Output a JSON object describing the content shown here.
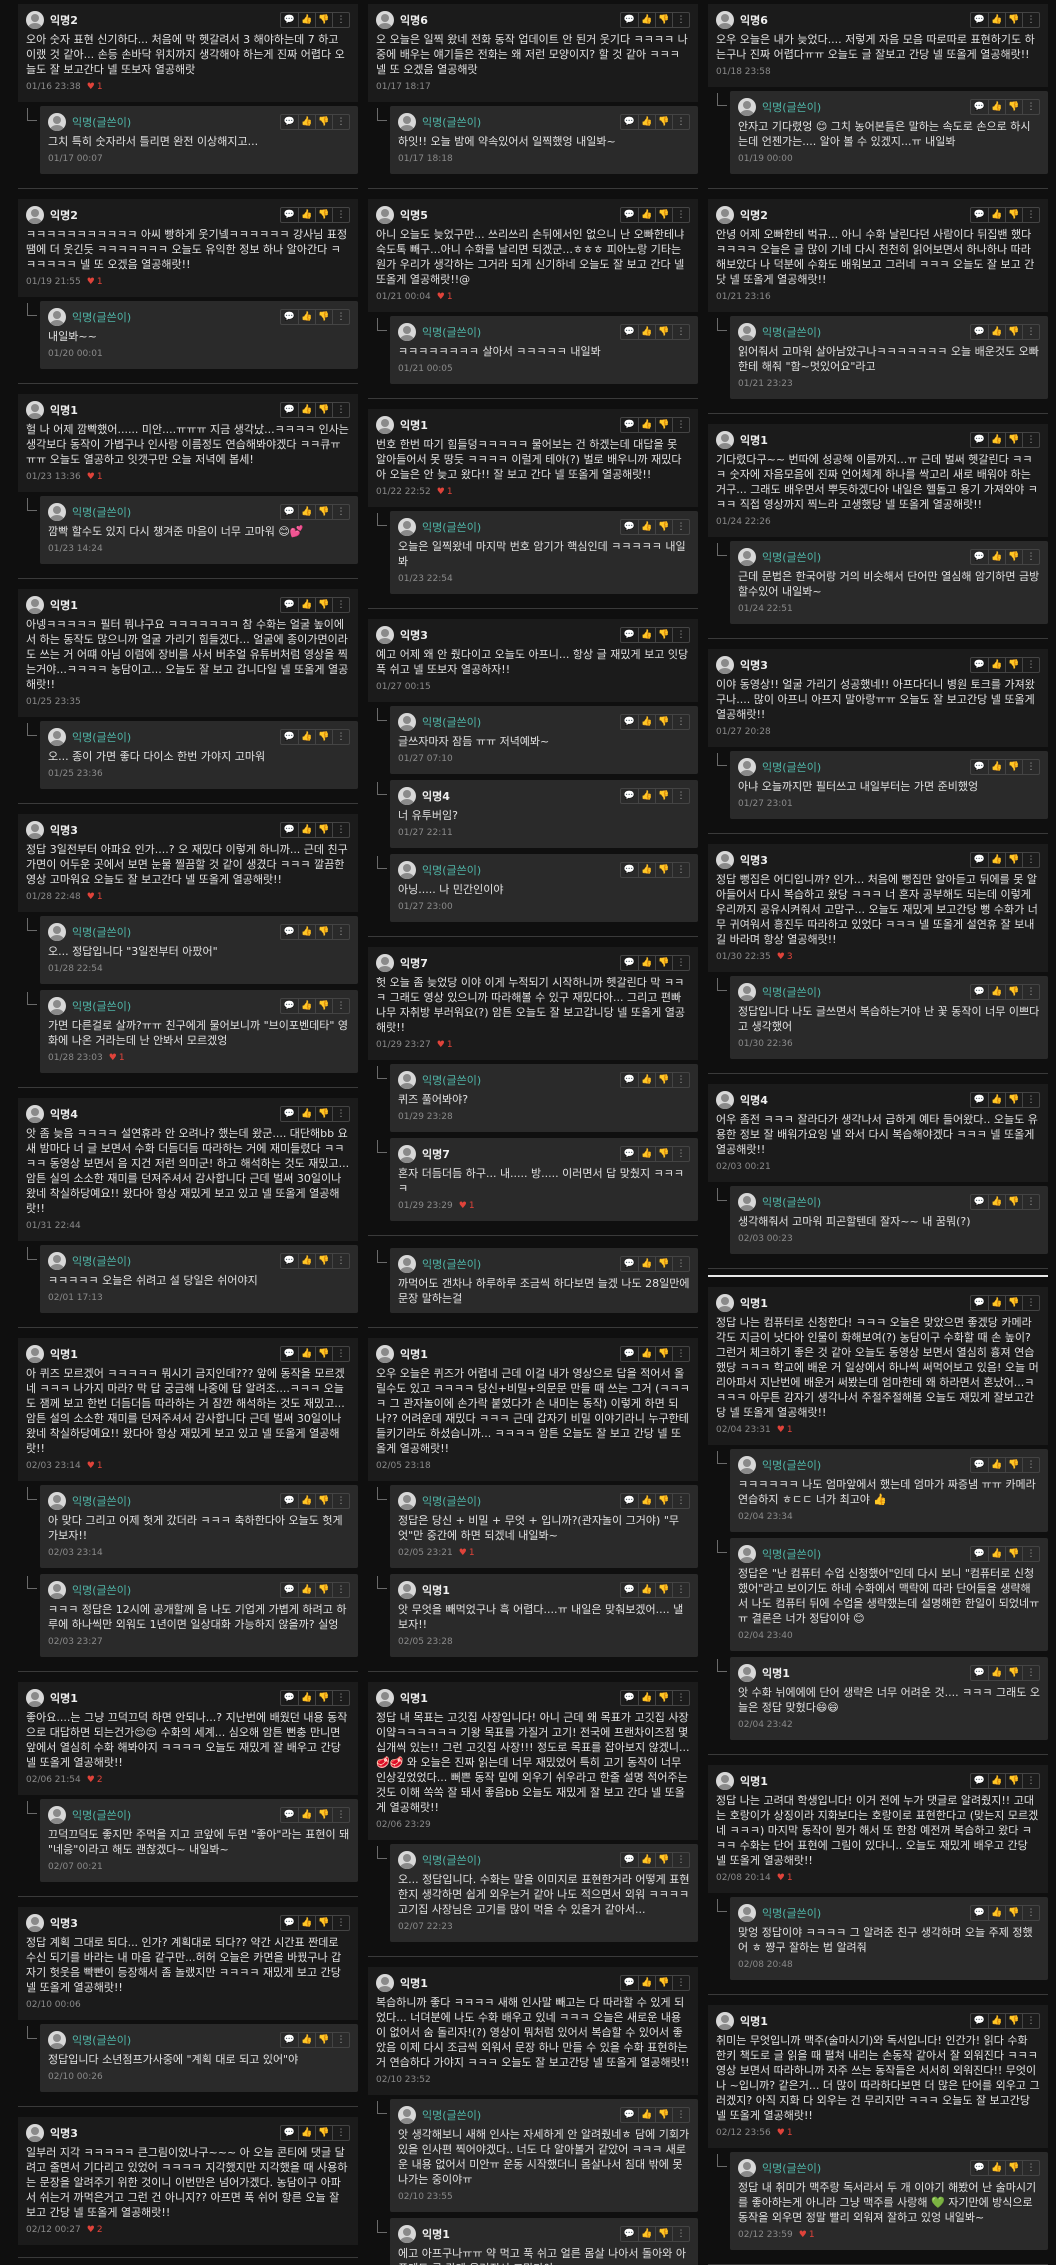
{
  "icons": {
    "comment": "speech-bubble-icon",
    "like": "thumbs-up-icon",
    "dislike": "thumbs-down-icon",
    "more": "more-icon",
    "heart": "heart-icon"
  },
  "columns": [
    [
      {
        "name": "익명2",
        "text": "오아 숫자 표현 신기하다... 처음에 막 헷갈려서 3 해야하는데 7 하고 이랬 것 같아... 손등 손바닥 위치까지 생각해야 하는게 진짜 어렵다 오늘도 잘 보고간다 넬 또보자 열공해랏",
        "time": "01/16 23:38",
        "likes": "1",
        "replies": [
          {
            "name": "익명(글쓴이)",
            "op": true,
            "text": "그치 특히 숫자라서 틀리면 완전 이상해지고...",
            "time": "01/17 00:07",
            "likes": ""
          }
        ]
      },
      {
        "name": "익명2",
        "text": "ㅋㅋㅋㅋㅋㅋㅋㅋㅋㅋㅋ 아씨 빵하게 웃기넼ㅋㅋㅋㅋㅋㅋ 강사님 표정 땜에 더 웃긴듯 ㅋㅋㅋㅋㅋㅋㅋ 오늘도 유익한 정보 하나 알아간다 ㅋㅋㅋㅋㅋㅋ 넬 또 오겠음 열공해랏!!",
        "time": "01/19 21:55",
        "likes": "1",
        "replies": [
          {
            "name": "익명(글쓴이)",
            "op": true,
            "text": "내일봐~~",
            "time": "01/20 00:01",
            "likes": ""
          }
        ]
      },
      {
        "name": "익명1",
        "text": "헐 나 어제 깜빡했어...... 미안....ㅠㅠㅠ 지금 생각났...ㅋㅋㅋㅋ 인사는 생각보다 동작이 가볍구나 인사랑 이름정도 연습해봐야겠다 ㅋㅋ큐ㅠㅠㅠ 오늘도 열공하고 잇갯구만 오늘 저녁에 봅세!",
        "time": "01/23 13:36",
        "likes": "1",
        "replies": [
          {
            "name": "익명(글쓴이)",
            "op": true,
            "text": "깜빡 할수도 있지 다시 챙겨준 마음이 너무 고마워 😊💕",
            "time": "01/23 14:24",
            "likes": ""
          }
        ]
      },
      {
        "name": "익명1",
        "text": "아넹ㅋㅋㅋㅋㅋ 필터 뭐냐구요 ㅋㅋㅋㅋㅋㅋㅋ 참 수화는 얼굴 높이에서 하는 동작도 많으니까 얼굴 가리기 힘들겠다... 얼굴에 종이가면이라도 쓰는 거 어떄 아님 이럼에 장비를 사서 버추얼 유튜버처럼 영상을 찍는거야...ㅋㅋㅋㅋ 농담이고... 오늘도 잘 보고 갑니다일 넬 또올게 열공해랏!!",
        "time": "01/25 23:35",
        "likes": "",
        "replies": [
          {
            "name": "익명(글쓴이)",
            "op": true,
            "text": "오... 종이 가면 좋다 다이소 한번 가야지 고마워",
            "time": "01/25 23:36",
            "likes": ""
          }
        ]
      },
      {
        "name": "익명3",
        "text": "정답 3일전부터 아파요 인가....? 오 재밌다 이렇게 하니까... 근데 친구 가면이 어두운 곳에서 보면 눈물 찔끔할 것 같이 생겼다 ㅋㅋㅋ 깔끔한 영상 고마워요 오늘도 잘 보고간다 넬 또올게 열공해랏!!",
        "time": "01/28 22:48",
        "likes": "1",
        "replies": [
          {
            "name": "익명(글쓴이)",
            "op": true,
            "text": "오... 정답입니다 \"3일전부터 아팠어\"",
            "time": "01/28 22:54",
            "likes": ""
          },
          {
            "name": "익명(글쓴이)",
            "op": true,
            "text": "가면 다른걸로 살까?ㅠㅠ 친구에게 물어보니까 \"브이포벤데타\" 영화에 나온 거라는데 난 안봐서 모르겠엉",
            "time": "01/28 23:03",
            "likes": "1"
          }
        ]
      },
      {
        "name": "익명4",
        "text": "앗 좀 늦음 ㅋㅋㅋㅋ 설연휴라 안 오려나? 했는데 왔군.... 대단해bb 요새 밤마다 너 글 보면서 수화 더듬더듬 따라하는 거에 재미들렸다 ㅋㅋㅋㅋ 동영상 보면서 음 지건 저런 의미군! 하고 해석하는 것도 재밌고... 암튼 실의 소소한 재미를 던져주셔서 감사합니다 근데 벌써 30일이나 왔네 착실하당예요!! 왔다아 항상 재밌게 보고 있고 넬 또올게 열공해랏!!",
        "time": "01/31 22:44",
        "likes": "",
        "replies": [
          {
            "name": "익명(글쓴이)",
            "op": true,
            "text": "ㅋㅋㅋㅋㅋ 오늘은 쉬려고 설 당일은 쉬어야지",
            "time": "02/01 17:13",
            "likes": ""
          }
        ]
      },
      {
        "name": "익명1",
        "text": "아 퀴즈 모르겠어 ㅋㅋㅋㅋㅋ 뭐시기 금지인데??? 앞에 동작을 모르겠네 ㅋㅋㅋ 나가지 마라? 막 답 궁금해 나중에 답 알려조....ㅋㅋㅋ 오늘도 잼께 보고 한번 더듬더듬 따라하는 거 잠깐 해석하는 것도 재밌고... 암튼 설의 소소한 재미를 던져주셔서 감사합니다 근데 벌써 30일이나 왔네 착실하당예요!! 왔다아 항상 재밌게 보고 있고 넬 또올게 열공해랏!!",
        "time": "02/03 23:14",
        "likes": "1",
        "replies": [
          {
            "name": "익명(글쓴이)",
            "op": true,
            "text": "아 맞다 그리고 어제 헛게 갔더라 ㅋㅋㅋ 축하한다아 오늘도 헛게 가보자!!",
            "time": "02/03 23:14",
            "likes": ""
          },
          {
            "name": "익명(글쓴이)",
            "op": true,
            "text": "ㅋㅋㅋ 정답은 12시에 공개할께 음 나도 기업게 가볍게 하려고 하루에 하나씩만 외워도 1년이면 일상대화 가능하지 않을까? 실엉",
            "time": "02/03 23:27",
            "likes": ""
          }
        ]
      },
      {
        "name": "익명1",
        "text": "좋아요....는 그냥 끄덕끄덕 하면 안되나...? 지난번에 배웠던 내용 동작으로 대답하면 되는건가😌😌 수화의 세계... 심오해 암튼 뻔충 만니면 앞에서 열심히 수화 해봐야지 ㅋㅋㅋㅋ 오늘도 재밌게 잘 배우고 간당 넬 또올게 열공해랏!!",
        "time": "02/06 21:54",
        "likes": "2",
        "replies": [
          {
            "name": "익명(글쓴이)",
            "op": true,
            "text": "끄덕끄덕도 좋지만 주먹을 지고 코앞에 두면 \"좋아\"라는 표현이 돼 \"네응\"이라고 해도 괜찮겠다~ 내일봐~",
            "time": "02/07 00:21",
            "likes": ""
          }
        ]
      },
      {
        "name": "익명3",
        "text": "정답 계획 그대로 되다... 인가? 계획대로 되다?? 약간 시간표 짠데로 수신 되기를 바라는 내 마음 같구만...허허 오늘은 카면을 바꿨구나 갑자기 헛웃음 빡빤이 등장해서 좀 놀랬지만 ㅋㅋㅋㅋ 재밌게 보고 간당 넬 또올게 열공해랏!!",
        "time": "02/10 00:06",
        "likes": "",
        "replies": [
          {
            "name": "익명(글쓴이)",
            "op": true,
            "text": "정답입니다 소년점프가사중에 \"계획 대로 되고 있어\"야",
            "time": "02/10 00:26",
            "likes": ""
          }
        ]
      },
      {
        "name": "익명3",
        "text": "일부러 지각 ㅋㅋㅋㅋㅋ 큰그림이었나구~~~ 아 오늘 콘티에 댓글 달려고 줄면서 기다리고 있었어 ㅋㅋㅋㅋ 지각했지만 지각했을 때 사용하는 문장을 알려주기 위한 것이니 이번만은 넘어가겠다. 농담이구 아파서 쉬는거 까먹은거고 그런 건 아니지?? 아프면 푹 쉬어 항른 오늘 잘 보고 간당 넬 또올게 열공해랏!!",
        "time": "02/12 00:27",
        "likes": "2",
        "replies": []
      }
    ],
    [
      {
        "name": "익명6",
        "text": "오 오늘은 일찍 왔네 전화 동작 업데이트 안 된거 웃기다 ㅋㅋㅋㅋ 나중에 배우는 얘기들은 전화는 왜 저런 모양이지? 할 것 같아 ㅋㅋㅋ 넬 또 오겠음 열공해랏",
        "time": "01/17 18:17",
        "likes": "",
        "replies": [
          {
            "name": "익명(글쓴이)",
            "op": true,
            "text": "하잇!! 오늘 밤에 약속있어서 일찍했엉 내일봐~",
            "time": "01/17 18:18",
            "likes": ""
          }
        ]
      },
      {
        "name": "익명5",
        "text": "아니 오늘도 늦었구만... 쓰리쓰리 손뒤에서인 없으니 난 오빠한테냐 숙도톡 빼구...아니 수화를 날리면 되겠군...ㅎㅎㅎ 피아노랑 기타는 원가 우리가 생각하는 그거라 되게 신기하네 오늘도 잘 보고 간다 넬 또올게 열공해랏!!@",
        "time": "01/21 00:04",
        "likes": "1",
        "replies": [
          {
            "name": "익명(글쓴이)",
            "op": true,
            "text": "ㅋㅋㅋㅋㅋㅋㅋㅋ 살아서 ㅋㅋㅋㅋㅋ 내일봐",
            "time": "01/21 00:05",
            "likes": ""
          }
        ]
      },
      {
        "name": "익명1",
        "text": "번호 한번 따기 힘들덩ㅋㅋㅋㅋㅋ 물어보는 건 하겠는데 대답을 못 알아들어서 못 땅듯 ㅋㅋㅋㅋ 이럴게 테야(?) 벌로 배우니까 재밌다아 오늘은 안 늦고 왔다!! 잘 보고 간다 넬 또올게 열공해랏!!",
        "time": "01/22 22:52",
        "likes": "1",
        "replies": [
          {
            "name": "익명(글쓴이)",
            "op": true,
            "text": "오늘은 일찍왔네 마지막 번호 암기가 핵심인데 ㅋㅋㅋㅋㅋ 내일봐",
            "time": "01/23 22:54",
            "likes": ""
          }
        ]
      },
      {
        "name": "익명3",
        "text": "예고 어제 왜 안 줬다이고 오늘도 아프니... 항상 글 재밌게 보고 잇당 푹 쉬고 넬 또보자 열공하자!!",
        "time": "01/27 00:15",
        "likes": "",
        "replies": [
          {
            "name": "익명(글쓴이)",
            "op": true,
            "text": "글쓰자마자 잠듬 ㅠㅠ 저녁예봐~",
            "time": "01/27 07:10",
            "likes": ""
          },
          {
            "name": "익명4",
            "op": false,
            "text": "너 유투버임?",
            "time": "01/27 22:11",
            "likes": ""
          },
          {
            "name": "익명(글쓴이)",
            "op": true,
            "text": "아닝..... 나 민간인이야",
            "time": "01/27 23:00",
            "likes": ""
          }
        ]
      },
      {
        "name": "익명7",
        "text": "헛 오늘 좀 늦었당 이야 이게 누적되기 시작하니까 헷갈린다 막 ㅋㅋㅋ 그래도 영상 있으니까 따라해볼 수 있구 재밌다아... 그리고 편빠나무 자취방 부러워요(?) 암튼 오늘도 잘 보고갑니당 넬 또올게 열공해랏!!",
        "time": "01/29 23:27",
        "likes": "1",
        "replies": [
          {
            "name": "익명(글쓴이)",
            "op": true,
            "text": "퀴즈 풀어봐야?",
            "time": "01/29 23:28",
            "likes": ""
          },
          {
            "name": "익명7",
            "op": false,
            "text": "혼자 더듬더듬 하구... 내..... 방..... 이러면서 답 맞췄지 ㅋㅋㅋㅋ",
            "time": "01/29 23:29",
            "likes": "1"
          }
        ]
      },
      {
        "name": "익명(글쓴이)",
        "op": true,
        "text": "까먹어도 갠차나 하루하루 조금씩 하다보면 늘겠 나도 28일만에 문장 말하는걸",
        "time": "",
        "likes": "",
        "replies": []
      },
      {
        "name": "익명1",
        "text": "오우 오늘은 퀴즈가 어렵네 근데 이걸 내가 영상으로 답을 적어서 올릴수도 있고 ㅋㅋㅋㅋ 당신+비밀+의문문 만들 때 쓰는 그거 (ㅋㅋㅋㅋ 그 관자놀이에 손가락 붙였다가 손 내미는 동작) 이렇게 하면 되나?? 어려운데 재밌다 ㅋㅋㅋ 근데 갑자기 비밀 이야기라니 누구한테 들키기라도 하셨습니까... ㅋㅋㅋㅋ 암튼 오늘도 잘 보고 간당 넬 또올게 열공해랏!!",
        "time": "02/05 23:18",
        "likes": "",
        "replies": [
          {
            "name": "익명(글쓴이)",
            "op": true,
            "text": "정답은 당신 + 비밀 + 무엇 + 입니까?(관자놀이 그거야) \"무엇\"만 중간에 하면 되겠네 내일봐~",
            "time": "02/05 23:21",
            "likes": "1"
          },
          {
            "name": "익명1",
            "op": false,
            "text": "앗 무엇을 빼먹었구나 흑 어렵다....ㅠ 내일은 맞춰보겠어.... 낼보자!!",
            "time": "02/05 23:28",
            "likes": ""
          }
        ]
      },
      {
        "name": "익명1",
        "text": "정답 내 목표는 고깃집 사장입니다! 아니 근데 왜 목표가 고깃집 사장이얔ㅋㅋㅋㅋㅋㅋ 기왕 목표를 가질거 고기! 전국에 프랜차이즈점 몇십개씩 있는!! 그런 고깃집 사장!!! 정도로 목표를 잡아보지 않겠니...🥩🥩 와 오늘은 진짜 읽는데 너무 재밌었어 특히 고기 동작이 너무 인상깊었었다... 뻐쁜 동작 밑에 외우기 쉬우라고 한줄 설명 적어주는 것도 이해 쏙쏙 잘 돼서 좋음bb 오늘도 재밌게 잘 보고 간다 넬 또올게 열공해랏!!",
        "time": "02/06 23:29",
        "likes": "",
        "replies": [
          {
            "name": "익명(글쓴이)",
            "op": true,
            "text": "오... 정답입니다. 수화는 말을 이미지로 표현한거라 어떻게 표현한지 생각하면 쉽게 외우는거 같아 나도 적으면서 외워 ㅋㅋㅋㅋ 고기집 사장님은 고기를 많이 먹을 수 있을거 같아서...",
            "time": "02/07 22:23",
            "likes": ""
          }
        ]
      },
      {
        "name": "익명1",
        "text": "복습하니까 좋다 ㅋㅋㅋㅋ 새해 인사말 빼고는 다 따라할 수 있게 되었다... 너뎌분에 나도 수화 배우고 있네 ㅋㅋㅋ 오늘은 새로운 내용이 없어서 숨 돌리자!(?) 영상이 뭐처럼 있어서 복습할 수 있어서 좋았음 이제 다시 조금씩 외워서 문장 하나 만들 수 있을 수화 표현하는 거 연습하다 가야지 ㅋㅋㅋ 오늘도 잘 보고간당 넬 또올게 열공해랏!!",
        "time": "02/10 23:52",
        "likes": "",
        "replies": [
          {
            "name": "익명(글쓴이)",
            "op": true,
            "text": "앗 생각해보니 새해 인사는 자세하게 안 알려줬네ㅎ 담에 기회가 있을 인사편 찍어야겠다.. 너도 다 알아볼거 같았어 ㅋㅋㅋ 새로운 내용 없어서 미안ㅠ 운동 시작했더니 몸살나서 침대 밖에 못나가는 중이야ㅠ",
            "time": "02/10 23:55",
            "likes": ""
          },
          {
            "name": "익명1",
            "op": false,
            "text": "에고 아프구나ㅠㅠ 약 먹고 푹 쉬고 얼른 몸살 나아서 돌아와 아픈데도 글 감게 올려줘서 고맙다아",
            "time": "02/10 23:56",
            "likes": ""
          }
        ]
      }
    ],
    [
      {
        "name": "익명6",
        "text": "오우 오늘은 내가 늦었다.... 저렇게 자음 모음 따로따로 표현하기도 하는구나 진짜 어렵다ㅠㅠ 오늘도 글 잘보고 간당 넬 또올게 열공해랏!!",
        "time": "01/18 23:58",
        "likes": "",
        "replies": [
          {
            "name": "익명(글쓴이)",
            "op": true,
            "text": "안자고 기다렸엉 😊 그치 농어본들은 말하는 속도로 손으로 하시는데 언젠가는.... 알아 볼 수 있겠지...ㅠ 내일봐",
            "time": "01/19 00:00",
            "likes": ""
          }
        ]
      },
      {
        "name": "익명2",
        "text": "안녕 어제 오빠한테 벅규... 아니 수화 날린다던 사람이다 뒤집밴 했다 ㅋㅋㅋㅋ 오늘은 글 많이 기네 다시 천천히 읽어보면서 하나하나 따라해보았다 나 덕분에 수화도 배워보고 그러네 ㅋㅋㅋ 오늘도 잘 보고 간닷 넬 또올게 열공해랏!!",
        "time": "01/21 23:16",
        "likes": "",
        "replies": [
          {
            "name": "익명(글쓴이)",
            "op": true,
            "text": "읽어줘서 고마워 살아남았구나ㅋㅋㅋㅋㅋㅋㅋ 오늘 배운것도 오빠한테 해줘 \"함~멋있어요\"라고",
            "time": "01/21 23:23",
            "likes": ""
          }
        ]
      },
      {
        "name": "익명1",
        "text": "기다렸다구~~ 번따에 성공해 이름까지...ㅠ 근데 벌써 헷갈린다 ㅋㅋㅋ 숫자에 자음모음에 진짜 언어체계 하나를 싹고리 새로 배워야 하는거구... 그래도 배우면서 뿌듯하겠다아 내일은 헬돌고 용기 가져와야 ㅋㅋㅋ 직접 영상까지 찍느라 고생했당 넬 또올게 열공해랏!!",
        "time": "01/24 22:26",
        "likes": "",
        "replies": [
          {
            "name": "익명(글쓴이)",
            "op": true,
            "text": "근데 문법은 한국어랑 거의 비슷해서 단어만 열심해 암기하면 금방 할수있어 내일봐~",
            "time": "01/24 22:51",
            "likes": ""
          }
        ]
      },
      {
        "name": "익명3",
        "text": "이야 동영상!! 얼굴 가리기 성공했네!! 아프다더니 병원 토크를 가져왔구나.... 많이 아프니 아프지 말아랑ㅠㅠ 오늘도 잘 보고간당 넬 또올게 열공해랏!!",
        "time": "01/27 20:28",
        "likes": "",
        "replies": [
          {
            "name": "익명(글쓴이)",
            "op": true,
            "text": "아냐 오늘까지만 필터쓰고 내일부터는 가면 준비했엉",
            "time": "01/27 23:01",
            "likes": ""
          }
        ]
      },
      {
        "name": "익명3",
        "text": "정답 뻥집은 어디입니까? 인가... 처음에 뻥집만 알아듣고 뒤에를 못 알아들어서 다시 복습하고 왔당 ㅋㅋㅋ 너 혼자 공부해도 되는데 이렇게 우리까지 공유시켜줘서 고맙구... 오늘도 재밌게 보고간당 뻥 수화가 너무 귀여워서 흥진두 따라하고 있었다 ㅋㅋㅋ 넬 또올게 설연휴 잘 보내길 바라며 항상 열공해랏!!",
        "time": "01/30 22:35",
        "likes": "3",
        "replies": [
          {
            "name": "익명(글쓴이)",
            "op": true,
            "text": "정답입니다 나도 글쓰면서 복습하는거야 난 꽃 동작이 너무 이쁘다고 생각했어",
            "time": "01/30 22:36",
            "likes": ""
          }
        ]
      },
      {
        "name": "익명4",
        "text": "어우 좀전 ㅋㅋㅋ 잘라다가 생각나서 급하게 예타 들어왔다.. 오늘도 유용한 정보 잘 배워가요잉 넬 와서 다시 복습해야겠다 ㅋㅋㅋ 넬 또올게 열공해랏!!",
        "time": "02/03 00:21",
        "likes": "",
        "replies": [
          {
            "name": "익명(글쓴이)",
            "op": true,
            "text": "생각해줘서 고마워 피곤할텐데 잘자~~ 내 꿈뭐(?)",
            "time": "02/03 00:23",
            "likes": ""
          }
        ]
      },
      {
        "sep": true
      },
      {
        "name": "익명1",
        "text": "정답 나는 컴퓨터로 신청한다! ㅋㅋㅋ 오늘은 맞았으면 좋겠당 카메라 각도 지금이 낫다아 인물이 화해보여(?) 농담이구 수화할 때 손 높이? 그런거 체크하기 좋은 것 같아 오늘도 동영상 보면서 열심히 흉져 연습했당 ㅋㅋㅋ 학교에 배운 거 일상에서 하나씩 써먹어보고 있음! 오늘 머리아파서 지난번에 배운거 써봤는데 엄마한테 왜 하라면서 혼났어...ㅋㅋㅋㅋ 아무튼 감자기 생각나서 주절주절해봄 오늘도 재밌게 잘보고간당 넬 또올게 열공해랏!!",
        "time": "02/04 23:31",
        "likes": "1",
        "replies": [
          {
            "name": "익명(글쓴이)",
            "op": true,
            "text": "ㅋㅋㅋㅋㅋㅋ 나도 엄마앞에서 했는데 엄마가 짜증냄 ㅠㅠ 카메라 연습하지 ㅎㄷㄷ 너가 최고야 👍",
            "time": "02/04 23:34",
            "likes": ""
          },
          {
            "name": "익명(글쓴이)",
            "op": true,
            "text": "정답은 \"난 컴퓨터 수업 신청했어\"인데 다시 보니 \"컴퓨터로 신청했어\"라고 보이기도 하네 수화에서 맥락에 따라 단어들을 생략해서 나도 컴퓨터 뒤에 수업을 생략했는데 설명해한 한일이 되었네ㅠㅠ 결론은 너가 정답이야 😊",
            "time": "02/04 23:40",
            "likes": ""
          },
          {
            "name": "익명1",
            "op": false,
            "text": "앗 수화 뉘에에에 단어 생략은 너무 어려운 것.... ㅋㅋㅋ 그래도 오늘은 정답 맞혔다😄😄",
            "time": "02/04 23:42",
            "likes": ""
          }
        ]
      },
      {
        "name": "익명1",
        "text": "정답 나는 고려대 학생입니다! 이거 전에 누가 댓글로 알려줬지!! 고대는 호랑이가 상징이라 지화보다는 호랑이로 표현한다고 (맞는지 모르겠네 ㅋㅋㅋ) 마지막 동작이 뭔가 해서 또 한참 예전꺼 복습하고 왔다 ㅋㅋㅋ 수화는 단어 표현에 그림이 있다니.. 오늘도 재밌게 배우고 간당 넬 또올게 열공해랏!!",
        "time": "02/08 20:14",
        "likes": "1",
        "replies": [
          {
            "name": "익명(글쓴이)",
            "op": true,
            "text": "맞엉 정답이야 ㅋㅋㅋㅋ 그 알려준 친구 생각하며 오늘 주제 정했어 ㅎ 쨩구 잘하는 법 알려줘",
            "time": "02/08 20:48",
            "likes": ""
          }
        ]
      },
      {
        "name": "익명1",
        "text": "취미는 무엇입니까 맥주(술마시기)와 독서입니다! 인간가! 읽다 수화 한키 책도로 글 읽을 때 펼쳐 내리는 손동작 같아서 잘 외워진다 ㅋㅋㅋ 영상 보면서 따라하니까 자주 쓰는 동작들은 서서히 외워진다!! 무엇이나 ~입니까? 같은거... 더 많이 따라하다보면 더 많은 단어를 외우고 그러겠지? 아직 지화 다 외우는 건 무리지만 ㅋㅋㅋ 오늘도 잘 보고간당 넬 또올게 열공해랏!!",
        "time": "02/12 23:56",
        "likes": "1",
        "replies": [
          {
            "name": "익명(글쓴이)",
            "op": true,
            "text": "정답 내 취미가 맥주랑 독서라서 두 개 이야기 해봤어 난 술마시기를 좋아하는게 아니라 그냥 맥주를 사랑해 💚 자기만에 방식으로 동작을 외우면 정말 빨리 외워져 잘하고 있엉 내일봐~",
            "time": "02/12 23:59",
            "likes": "1"
          }
        ]
      }
    ]
  ]
}
